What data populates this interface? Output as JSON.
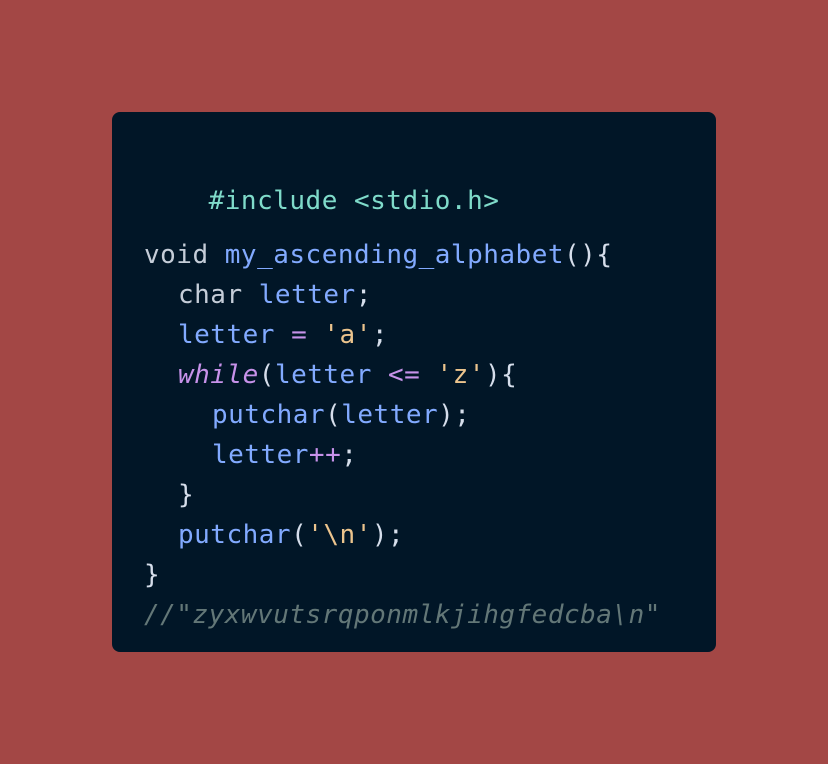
{
  "background_color": "#a34745",
  "card_color": "#011627",
  "code": {
    "line1": {
      "text": "#include <stdio.h>"
    },
    "line3": {
      "kw": "void",
      "fn": "my_ascending_alphabet",
      "tail": "(){"
    },
    "line4": {
      "kw": "char",
      "ident": "letter",
      "end": ";"
    },
    "line5": {
      "ident": "letter",
      "op": " = ",
      "str": "'a'",
      "end": ";"
    },
    "line6": {
      "kw": "while",
      "p1": "(",
      "ident": "letter",
      "op": " <= ",
      "str": "'z'",
      "tail": "){"
    },
    "line7": {
      "fn": "putchar",
      "p1": "(",
      "ident": "letter",
      "tail": ");"
    },
    "line8": {
      "ident": "letter",
      "op": "++",
      "end": ";"
    },
    "line9": {
      "text": "}"
    },
    "line10": {
      "fn": "putchar",
      "p1": "(",
      "str": "'\\n'",
      "tail": ");"
    },
    "line11": {
      "text": "}"
    },
    "line12": {
      "text": "//\"zyxwvutsrqponmlkjihgfedcba\\n\""
    }
  }
}
